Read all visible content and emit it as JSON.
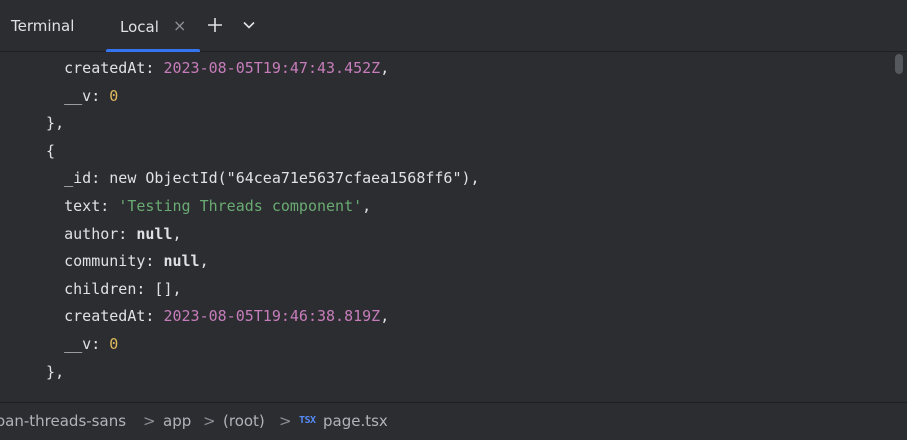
{
  "header": {
    "title": "Terminal",
    "tab_label": "Local",
    "tab_close": "×",
    "add_tab_icon": "plus-icon",
    "dropdown_icon": "chevron-down-icon"
  },
  "terminal": {
    "lines": [
      {
        "indent": "    ",
        "key": "createdAt: ",
        "value": "2023-08-05T19:47:43.452Z",
        "value_class": "date",
        "suffix": ","
      },
      {
        "indent": "    ",
        "key": "__v: ",
        "value": "0",
        "value_class": "num",
        "suffix": ""
      },
      {
        "indent": "  ",
        "key": "},",
        "value": "",
        "value_class": "",
        "suffix": ""
      },
      {
        "indent": "  ",
        "key": "{",
        "value": "",
        "value_class": "",
        "suffix": ""
      },
      {
        "indent": "    ",
        "key": "_id: new ObjectId(\"64cea71e5637cfaea1568ff6\"),",
        "value": "",
        "value_class": "",
        "suffix": ""
      },
      {
        "indent": "    ",
        "key": "text: ",
        "value": "'Testing Threads component'",
        "value_class": "str",
        "suffix": ","
      },
      {
        "indent": "    ",
        "key": "author: ",
        "value": "null",
        "value_class": "kw",
        "suffix": ","
      },
      {
        "indent": "    ",
        "key": "community: ",
        "value": "null",
        "value_class": "kw",
        "suffix": ","
      },
      {
        "indent": "    ",
        "key": "children: [],",
        "value": "",
        "value_class": "",
        "suffix": ""
      },
      {
        "indent": "    ",
        "key": "createdAt: ",
        "value": "2023-08-05T19:46:38.819Z",
        "value_class": "date",
        "suffix": ","
      },
      {
        "indent": "    ",
        "key": "__v: ",
        "value": "0",
        "value_class": "num",
        "suffix": ""
      },
      {
        "indent": "  ",
        "key": "},",
        "value": "",
        "value_class": "",
        "suffix": ""
      }
    ]
  },
  "breadcrumbs": {
    "project": "oan-threads-sans",
    "app": "app",
    "root": "(root)",
    "file_icon_text": "TSX",
    "file": "page.tsx",
    "separator": ">"
  },
  "colors": {
    "accent": "#3574f0",
    "string": "#6aab73",
    "date": "#c77dbb",
    "number": "#e2b95d",
    "background": "#2b2d30"
  }
}
